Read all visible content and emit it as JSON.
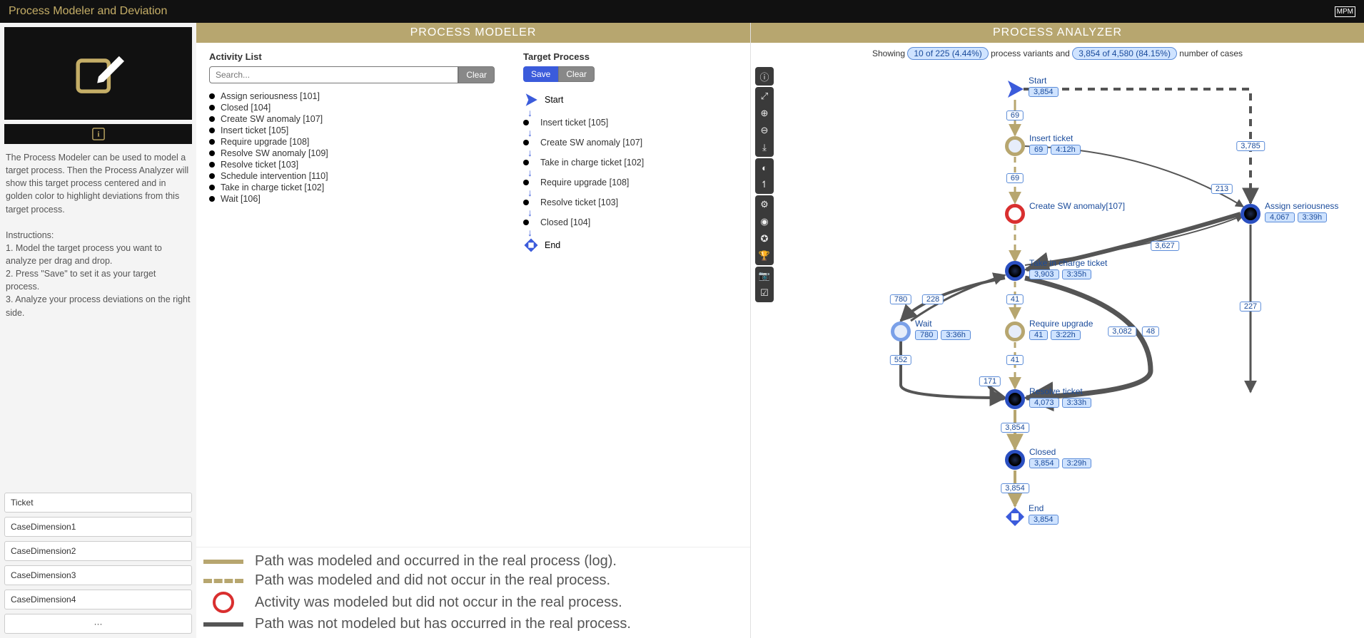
{
  "header": {
    "title": "Process Modeler and Deviation",
    "brand": "MPM"
  },
  "sidebar": {
    "description_lines": [
      "The Process Modeler can be used to model a target process. Then the Process Analyzer will show this target process centered and in golden color to highlight deviations from this target process.",
      "",
      "Instructions:",
      "1. Model the target process you want to analyze per drag and drop.",
      "2. Press \"Save\" to set it as your target process.",
      "3. Analyze your process deviations on the right side."
    ],
    "fields": [
      "Ticket",
      "CaseDimension1",
      "CaseDimension2",
      "CaseDimension3",
      "CaseDimension4"
    ],
    "more": "···"
  },
  "modeler": {
    "title": "PROCESS MODELER",
    "activity_head": "Activity List",
    "target_head": "Target Process",
    "search_placeholder": "Search...",
    "clear_btn": "Clear",
    "save_btn": "Save",
    "clear2_btn": "Clear",
    "activities": [
      "Assign seriousness [101]",
      "Closed [104]",
      "Create SW anomaly [107]",
      "Insert ticket [105]",
      "Require upgrade [108]",
      "Resolve SW anomaly [109]",
      "Resolve ticket [103]",
      "Schedule intervention [110]",
      "Take in charge ticket [102]",
      "Wait [106]"
    ],
    "flow_start": "Start",
    "flow_end": "End",
    "flow_steps": [
      "Insert ticket [105]",
      "Create SW anomaly [107]",
      "Take in charge ticket [102]",
      "Require upgrade [108]",
      "Resolve ticket [103]",
      "Closed [104]"
    ]
  },
  "legend": {
    "l1": "Path was modeled and occurred in the real process (log).",
    "l2": "Path was modeled and did not occur in the real process.",
    "l3": "Activity was modeled but did not occur in the real process.",
    "l4": "Path was not modeled but has occurred in the real process."
  },
  "analyzer": {
    "title": "PROCESS ANALYZER",
    "showing_pre": "Showing",
    "variants_pill": "10 of 225 (4.44%)",
    "variants_post": "process variants and",
    "cases_pill": "3,854 of 4,580 (84.15%)",
    "cases_post": "number of cases",
    "nodes": {
      "start": {
        "label": "Start",
        "count": "3,854"
      },
      "insert": {
        "label": "Insert ticket",
        "count": "69",
        "time": "4:12h"
      },
      "anomaly": {
        "label": "Create SW anomaly[107]"
      },
      "assign": {
        "label": "Assign seriousness",
        "count": "4,067",
        "time": "3:39h"
      },
      "take": {
        "label": "Take in charge ticket",
        "count": "3,903",
        "time": "3:35h"
      },
      "wait": {
        "label": "Wait",
        "count": "780",
        "time": "3:36h"
      },
      "require": {
        "label": "Require upgrade",
        "count": "41",
        "time": "3:22h"
      },
      "resolve": {
        "label": "Resolve ticket",
        "count": "4,073",
        "time": "3:33h"
      },
      "closed": {
        "label": "Closed",
        "count": "3,854",
        "time": "3:29h"
      },
      "end": {
        "label": "End",
        "count": "3,854"
      }
    },
    "edges": {
      "e69a": "69",
      "e3785": "3,785",
      "e69b": "69",
      "e213": "213",
      "e3627": "3,627",
      "e780": "780",
      "e228": "228",
      "e41a": "41",
      "e3082": "3,082",
      "e48": "48",
      "e227": "227",
      "e552": "552",
      "e41b": "41",
      "e171": "171",
      "e3854a": "3,854",
      "e3854b": "3,854"
    }
  }
}
